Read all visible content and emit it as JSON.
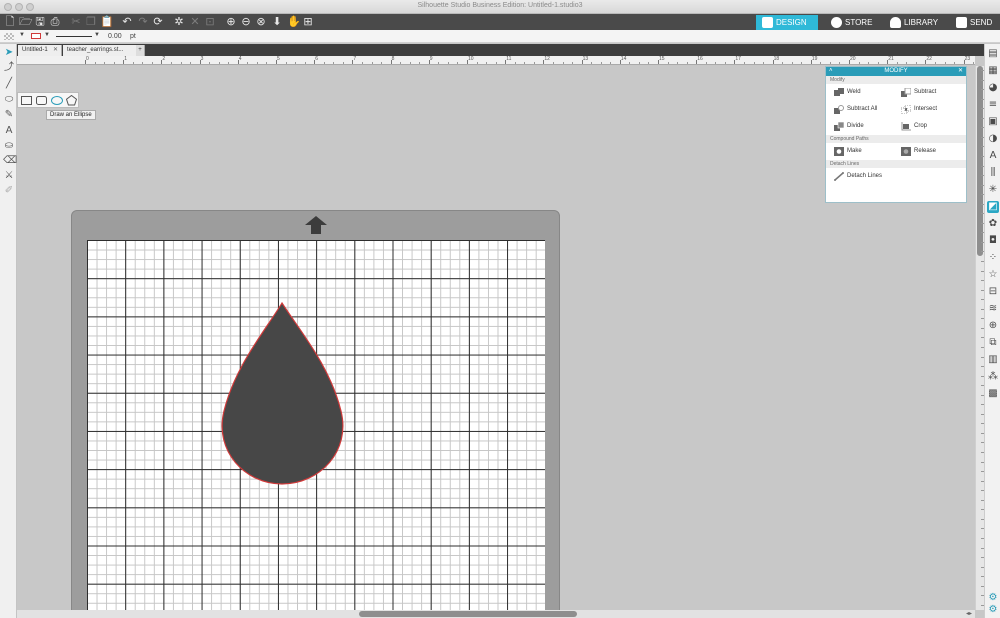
{
  "window": {
    "title": "Silhouette Studio Business Edition: Untitled-1.studio3"
  },
  "nav": {
    "design": "DESIGN",
    "store": "STORE",
    "library": "LIBRARY",
    "send": "SEND"
  },
  "properties": {
    "line_width": "0.00",
    "unit": "pt"
  },
  "tabs": [
    {
      "label": "Untitled-1"
    },
    {
      "label": "teacher_earrings.st..."
    }
  ],
  "tab_add_label": "+",
  "ruler": {
    "labels": [
      "0",
      "1",
      "2",
      "3",
      "4",
      "5",
      "6",
      "7",
      "8",
      "9",
      "10",
      "11",
      "12",
      "13",
      "14",
      "15",
      "16",
      "17",
      "18",
      "19",
      "20",
      "21",
      "22",
      "23"
    ]
  },
  "tooltip": "Draw an Ellipse",
  "modify_panel": {
    "title": "MODIFY",
    "section_modify": "Modify",
    "weld": "Weld",
    "subtract": "Subtract",
    "subtract_all": "Subtract All",
    "intersect": "Intersect",
    "divide": "Divide",
    "crop": "Crop",
    "section_compound": "Compound Paths",
    "make": "Make",
    "release": "Release",
    "section_detach": "Detach Lines",
    "detach_lines": "Detach Lines"
  },
  "colors": {
    "accent": "#2fb9d8",
    "toolbar_bg": "#4a4a4a",
    "shape_fill": "#4a4a4a",
    "shape_stroke": "#d03a3a"
  }
}
